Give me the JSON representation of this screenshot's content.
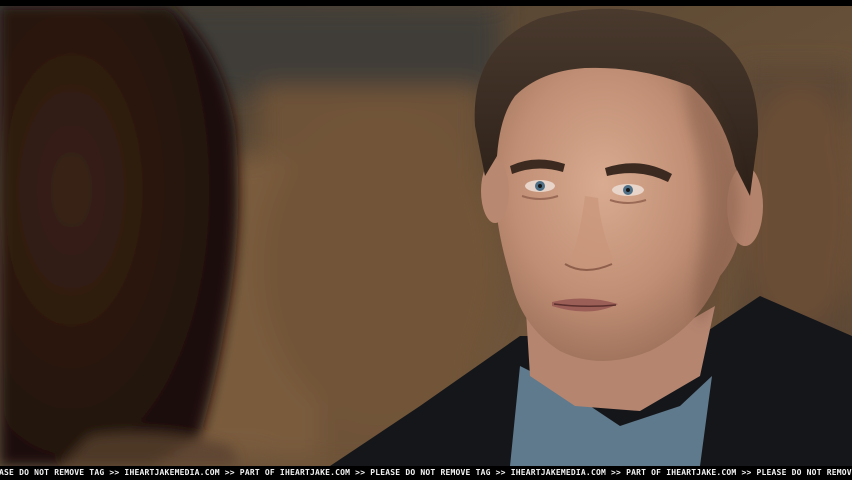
{
  "watermark": {
    "text": "EASE DO NOT REMOVE TAG >> IHEARTJAKEMEDIA.COM >> PART OF IHEARTJAKE.COM >> PLEASE DO NOT REMOVE TAG >> IHEARTJAKEMEDIA.COM >> PART OF IHEARTJAKE.COM >> PLEASE DO NOT REMOVE TAG >> IHEARTJAKE"
  },
  "colors": {
    "background_blur": "#5a4632",
    "foliage": "#6e5238",
    "skin": "#c89a82",
    "hair": "#3a2c22",
    "jacket": "#15161a",
    "tshirt": "#5f7a8c",
    "foreground_hair": "#24140c",
    "letterbox": "#000000"
  }
}
